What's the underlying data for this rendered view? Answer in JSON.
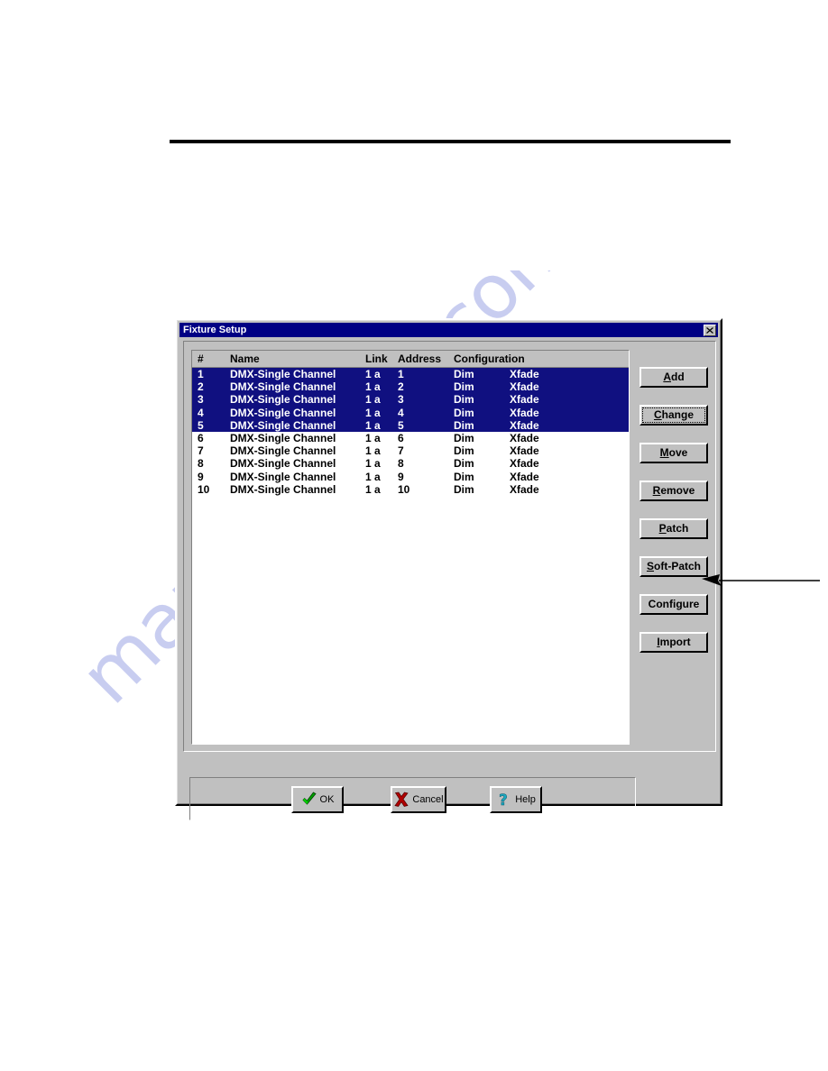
{
  "page": {
    "watermark_text": "manualshive.com",
    "rule": "horizontal-rule"
  },
  "dialog": {
    "title": "Fixture Setup",
    "close_icon": "close-icon",
    "accent_titlebar_color": "#000084",
    "selection_color": "#101080",
    "face_color": "#c0c0c0"
  },
  "list": {
    "columns": [
      "#",
      "Name",
      "Link",
      "Address",
      "Configuration"
    ],
    "rows": [
      {
        "num": "1",
        "name": "DMX-Single Channel",
        "link": "1 a",
        "address": "1",
        "cfg1": "Dim",
        "cfg2": "Xfade",
        "selected": true
      },
      {
        "num": "2",
        "name": "DMX-Single Channel",
        "link": "1 a",
        "address": "2",
        "cfg1": "Dim",
        "cfg2": "Xfade",
        "selected": true
      },
      {
        "num": "3",
        "name": "DMX-Single Channel",
        "link": "1 a",
        "address": "3",
        "cfg1": "Dim",
        "cfg2": "Xfade",
        "selected": true
      },
      {
        "num": "4",
        "name": "DMX-Single Channel",
        "link": "1 a",
        "address": "4",
        "cfg1": "Dim",
        "cfg2": "Xfade",
        "selected": true
      },
      {
        "num": "5",
        "name": "DMX-Single Channel",
        "link": "1 a",
        "address": "5",
        "cfg1": "Dim",
        "cfg2": "Xfade",
        "selected": true
      },
      {
        "num": "6",
        "name": "DMX-Single Channel",
        "link": "1 a",
        "address": "6",
        "cfg1": "Dim",
        "cfg2": "Xfade",
        "selected": false
      },
      {
        "num": "7",
        "name": "DMX-Single Channel",
        "link": "1 a",
        "address": "7",
        "cfg1": "Dim",
        "cfg2": "Xfade",
        "selected": false
      },
      {
        "num": "8",
        "name": "DMX-Single Channel",
        "link": "1 a",
        "address": "8",
        "cfg1": "Dim",
        "cfg2": "Xfade",
        "selected": false
      },
      {
        "num": "9",
        "name": "DMX-Single Channel",
        "link": "1 a",
        "address": "9",
        "cfg1": "Dim",
        "cfg2": "Xfade",
        "selected": false
      },
      {
        "num": "10",
        "name": "DMX-Single Channel",
        "link": "1 a",
        "address": "10",
        "cfg1": "Dim",
        "cfg2": "Xfade",
        "selected": false
      }
    ],
    "selected_count": 5
  },
  "side_buttons": [
    {
      "label": "Add",
      "accel": "A",
      "focused": false
    },
    {
      "label": "Change",
      "accel": "C",
      "focused": true
    },
    {
      "label": "Move",
      "accel": "M",
      "focused": false
    },
    {
      "label": "Remove",
      "accel": "R",
      "focused": false
    },
    {
      "label": "Patch",
      "accel": "P",
      "focused": false
    },
    {
      "label": "Soft-Patch",
      "accel": "S",
      "focused": false
    },
    {
      "label": "Configure",
      "accel": "",
      "focused": false
    },
    {
      "label": "Import",
      "accel": "I",
      "focused": false
    }
  ],
  "action_buttons": [
    {
      "label": "OK",
      "icon": "green-check-icon"
    },
    {
      "label": "Cancel",
      "icon": "red-x-icon"
    },
    {
      "label": "Help",
      "icon": "cyan-question-mark-icon"
    }
  ],
  "callout": {
    "target": "Soft-Patch",
    "icon": "leftward-arrow-annotation"
  }
}
